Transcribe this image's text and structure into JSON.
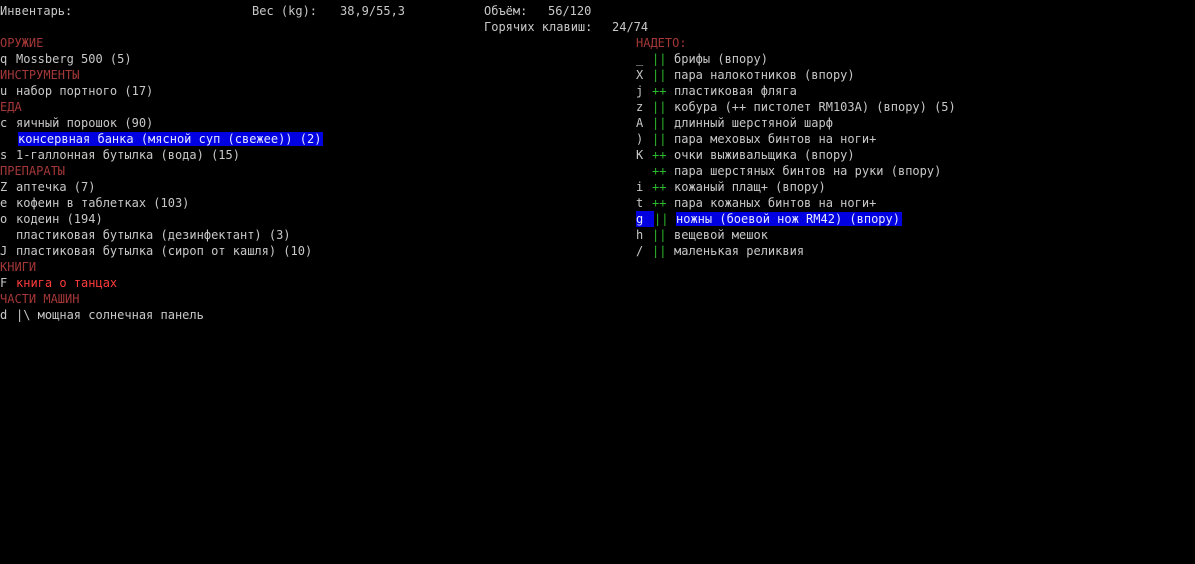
{
  "header": {
    "inventory_label": "Инвентарь:",
    "weight_label": "Вес (kg):",
    "weight_value": "38,9/55,3",
    "volume_label": "Объём:",
    "volume_value": "56/120",
    "hotkeys_label": "Горячих клавиш:",
    "hotkeys_value": "24/74"
  },
  "inventory": [
    {
      "type": "cat",
      "text": "ОРУЖИЕ"
    },
    {
      "type": "item",
      "key": "q",
      "text": "Mossberg 500 (5)"
    },
    {
      "type": "cat",
      "text": "ИНСТРУМЕНТЫ"
    },
    {
      "type": "item",
      "key": "u",
      "text": "набор портного (17)"
    },
    {
      "type": "cat",
      "text": "ЕДА"
    },
    {
      "type": "item",
      "key": "c",
      "text": "яичный порошок (90)"
    },
    {
      "type": "item",
      "key": "",
      "text": "консервная банка (мясной суп (свежее)) (2)",
      "selected": true
    },
    {
      "type": "item",
      "key": "s",
      "text": "1-галлонная бутылка (вода) (15)"
    },
    {
      "type": "cat",
      "text": "ПРЕПАРАТЫ"
    },
    {
      "type": "item",
      "key": "Z",
      "text": "аптечка (7)"
    },
    {
      "type": "item",
      "key": "e",
      "text": "кофеин в таблетках (103)"
    },
    {
      "type": "item",
      "key": "o",
      "text": "кодеин (194)"
    },
    {
      "type": "item",
      "key": "",
      "text": "пластиковая бутылка (дезинфектант) (3)"
    },
    {
      "type": "item",
      "key": "J",
      "text": "пластиковая бутылка (сироп от кашля) (10)"
    },
    {
      "type": "cat",
      "text": "КНИГИ"
    },
    {
      "type": "item",
      "key": "F",
      "text": "книга о танцах",
      "red": true
    },
    {
      "type": "cat",
      "text": "ЧАСТИ МАШИН"
    },
    {
      "type": "item",
      "key": "d",
      "text": "|\\ мощная солнечная панель"
    }
  ],
  "worn": {
    "title": "НАДЕТО:",
    "items": [
      {
        "key": "_",
        "mark": "||",
        "text": "брифы (впору)"
      },
      {
        "key": "X",
        "mark": "||",
        "text": "пара налокотников (впору)"
      },
      {
        "key": "j",
        "mark": "++",
        "text": "пластиковая фляга"
      },
      {
        "key": "z",
        "mark": "||",
        "text": "кобура (++ пистолет RM103A) (впору) (5)"
      },
      {
        "key": "A",
        "mark": "||",
        "text": "длинный шерстяной шарф"
      },
      {
        "key": ")",
        "mark": "||",
        "text": "пара меховых бинтов на ноги+"
      },
      {
        "key": "K",
        "mark": "++",
        "text": "очки выживальщика (впору)"
      },
      {
        "key": "",
        "mark": "++",
        "text": "пара шерстяных бинтов на руки (впору)"
      },
      {
        "key": "i",
        "mark": "++",
        "text": "кожаный плащ+ (впору)"
      },
      {
        "key": "t",
        "mark": "++",
        "text": "пара кожаных бинтов на ноги+"
      },
      {
        "key": "g",
        "mark": "||",
        "text": "ножны (боевой нож RM42) (впору)",
        "selected": true
      },
      {
        "key": "h",
        "mark": "||",
        "text": "вещевой мешок"
      },
      {
        "key": "/",
        "mark": "||",
        "text": "маленькая реликвия"
      }
    ]
  }
}
